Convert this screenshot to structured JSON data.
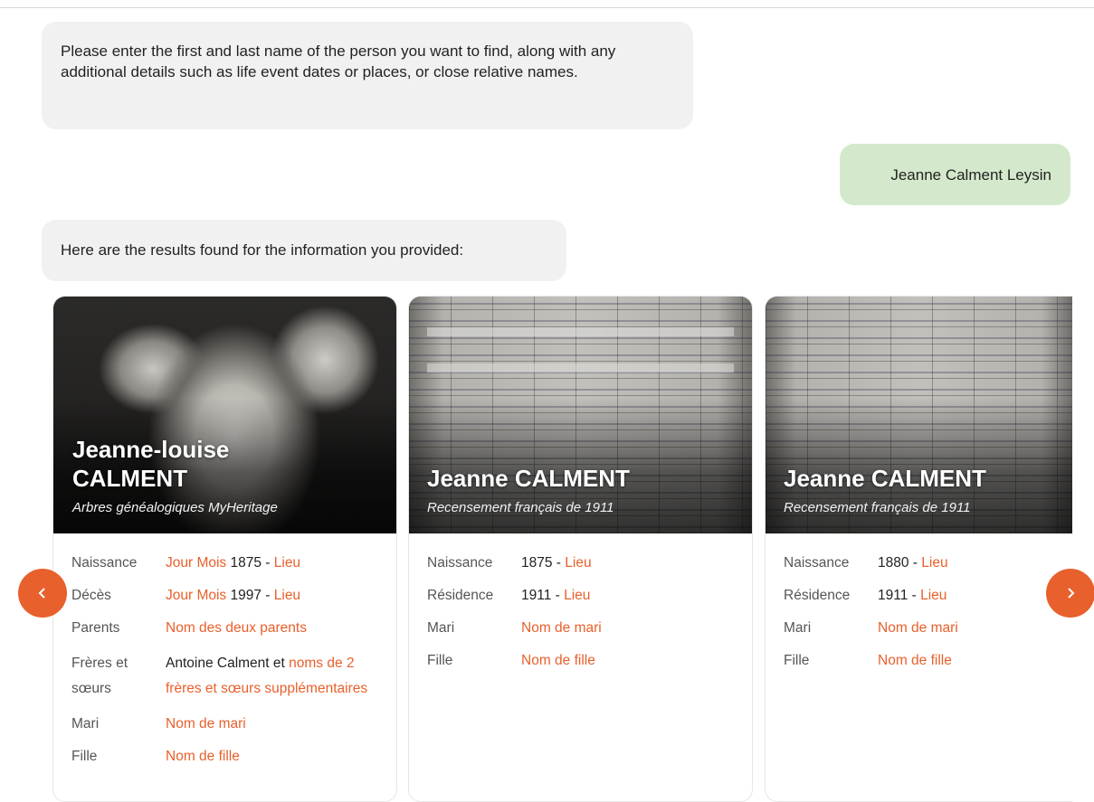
{
  "messages": {
    "bot_prompt": "Please enter the first and last name of the person you want to find, along with any additional details such as life event dates or places, or close relative names.",
    "user_query": "Jeanne Calment Leysin",
    "bot_results": "Here are the results found for the information you provided:"
  },
  "cards": [
    {
      "name_line1": "Jeanne-louise",
      "name_line2": "CALMENT",
      "source": "Arbres généalogiques MyHeritage",
      "image": "portrait-photo",
      "facts": [
        {
          "label": "Naissance",
          "parts": [
            {
              "text": "Jour Mois",
              "link": true
            },
            {
              "text": " 1875 - ",
              "link": false
            },
            {
              "text": "Lieu",
              "link": true
            }
          ]
        },
        {
          "label": "Décès",
          "parts": [
            {
              "text": "Jour Mois",
              "link": true
            },
            {
              "text": " 1997 - ",
              "link": false
            },
            {
              "text": "Lieu",
              "link": true
            }
          ]
        },
        {
          "label": "Parents",
          "parts": [
            {
              "text": "Nom des deux parents",
              "link": true
            }
          ]
        },
        {
          "label": "Frères et sœurs",
          "parts": [
            {
              "text": "Antoine Calment et ",
              "link": false
            },
            {
              "text": "noms de 2 frères et sœurs supplémentaires",
              "link": true
            }
          ]
        },
        {
          "label": "Mari",
          "parts": [
            {
              "text": "Nom de mari",
              "link": true
            }
          ]
        },
        {
          "label": "Fille",
          "parts": [
            {
              "text": "Nom de fille",
              "link": true
            }
          ]
        }
      ]
    },
    {
      "name_line1": "Jeanne CALMENT",
      "name_line2": "",
      "source": "Recensement français de 1911",
      "image": "census-document",
      "facts": [
        {
          "label": "Naissance",
          "parts": [
            {
              "text": "1875 - ",
              "link": false
            },
            {
              "text": "Lieu",
              "link": true
            }
          ]
        },
        {
          "label": "Résidence",
          "parts": [
            {
              "text": "1911 - ",
              "link": false
            },
            {
              "text": "Lieu",
              "link": true
            }
          ]
        },
        {
          "label": "Mari",
          "parts": [
            {
              "text": "Nom de mari",
              "link": true
            }
          ]
        },
        {
          "label": "Fille",
          "parts": [
            {
              "text": "Nom de fille",
              "link": true
            }
          ]
        }
      ]
    },
    {
      "name_line1": "Jeanne CALMENT",
      "name_line2": "",
      "source": "Recensement français de 1911",
      "image": "census-document",
      "facts": [
        {
          "label": "Naissance",
          "parts": [
            {
              "text": "1880 - ",
              "link": false
            },
            {
              "text": "Lieu",
              "link": true
            }
          ]
        },
        {
          "label": "Résidence",
          "parts": [
            {
              "text": "1911 - ",
              "link": false
            },
            {
              "text": "Lieu",
              "link": true
            }
          ]
        },
        {
          "label": "Mari",
          "parts": [
            {
              "text": "Nom de mari",
              "link": true
            }
          ]
        },
        {
          "label": "Fille",
          "parts": [
            {
              "text": "Nom de fille",
              "link": true
            }
          ]
        }
      ]
    }
  ],
  "nav": {
    "prev_icon": "chevron-left-icon",
    "next_icon": "chevron-right-icon"
  },
  "colors": {
    "accent": "#e8602c",
    "user_bubble": "#d4e9cc",
    "bot_bubble": "#f1f1f1"
  }
}
